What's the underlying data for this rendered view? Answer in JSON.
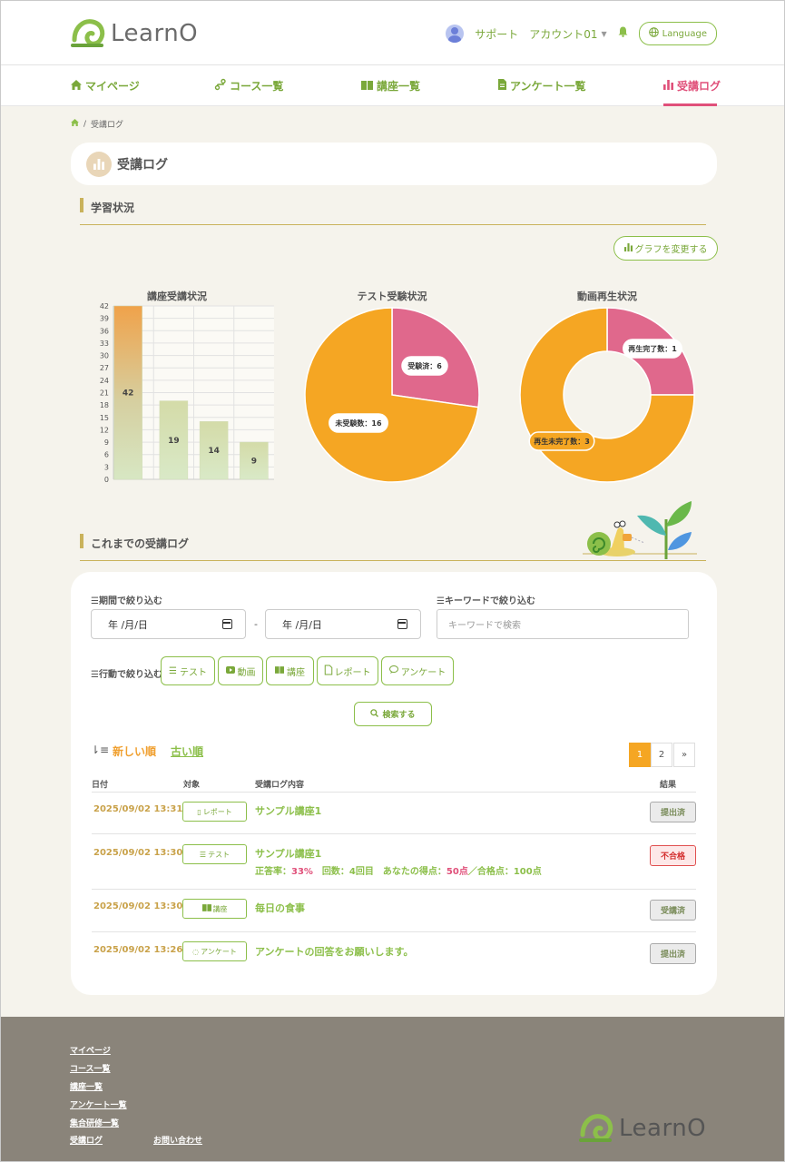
{
  "header": {
    "logo_text": "LearnO",
    "support": "サポート",
    "account": "アカウント01",
    "language": "Language"
  },
  "nav": [
    {
      "label": "マイページ",
      "icon": "home-icon"
    },
    {
      "label": "コース一覧",
      "icon": "route-icon"
    },
    {
      "label": "講座一覧",
      "icon": "book-icon"
    },
    {
      "label": "アンケート一覧",
      "icon": "doc-icon"
    },
    {
      "label": "受講ログ",
      "icon": "bar-chart-icon",
      "active": true
    }
  ],
  "breadcrumb": {
    "current": "受講ログ",
    "sep": "/"
  },
  "page_title": "受講ログ",
  "section1": {
    "heading": "学習状況",
    "graph_button": "グラフを変更する"
  },
  "chart_data": [
    {
      "type": "bar",
      "title": "講座受講状況",
      "categories": [
        "",
        "",
        "",
        ""
      ],
      "values": [
        42,
        19,
        14,
        9
      ],
      "ylim": [
        0,
        42
      ],
      "yticks": [
        0,
        3,
        6,
        9,
        12,
        15,
        18,
        21,
        24,
        27,
        30,
        33,
        36,
        39,
        42
      ],
      "grid": true
    },
    {
      "type": "pie",
      "title": "テスト受験状況",
      "slices": [
        {
          "label": "受験済",
          "value": 6,
          "color": "#e0688c"
        },
        {
          "label": "未受験数",
          "value": 16,
          "color": "#f5a623"
        }
      ]
    },
    {
      "type": "pie",
      "variant": "donut",
      "title": "動画再生状況",
      "slices": [
        {
          "label": "再生完了数",
          "value": 1,
          "color": "#e0688c"
        },
        {
          "label": "再生未完了数",
          "value": 3,
          "color": "#f5a623"
        }
      ]
    }
  ],
  "section2": {
    "heading": "これまでの受講ログ"
  },
  "filters": {
    "period_label": "期間で絞り込む",
    "date_from": "年 /月/日",
    "date_to": "年 /月/日",
    "date_sep": "-",
    "keyword_label": "キーワードで絞り込む",
    "keyword_placeholder": "キーワードで検索",
    "action_label": "行動で絞り込む",
    "chips": [
      "テスト",
      "動画",
      "講座",
      "レポート",
      "アンケート"
    ],
    "search_button": "検索する"
  },
  "sort": {
    "newest": "新しい順",
    "oldest": "古い順"
  },
  "pagination": {
    "pages": [
      "1",
      "2"
    ],
    "next": "»",
    "current": "1"
  },
  "table": {
    "headers": [
      "日付",
      "対象",
      "受講ログ内容",
      "結果"
    ],
    "rows": [
      {
        "date": "2025/09/02 13:31",
        "type": "レポート",
        "content": "サンプル講座1",
        "result": "提出済"
      },
      {
        "date": "2025/09/02 13:30",
        "type": "テスト",
        "content": "サンプル講座1",
        "detail_prefix": "正答率：",
        "rate": "33%",
        "detail_mid": "　回数：4回目　あなたの得点：",
        "score": "50点",
        "detail_suffix": "／合格点：100点",
        "result": "不合格"
      },
      {
        "date": "2025/09/02 13:30",
        "type": "講座",
        "content": "毎日の食事",
        "result": "受講済"
      },
      {
        "date": "2025/09/02 13:26",
        "type": "アンケート",
        "content": "アンケートの回答をお願いします。",
        "result": "提出済"
      }
    ]
  },
  "footer": {
    "links": [
      "マイページ",
      "コース一覧",
      "講座一覧",
      "アンケート一覧",
      "集合研修一覧",
      "受講ログ"
    ],
    "contact": "お問い合わせ",
    "logo_text": "LearnO"
  },
  "colors": {
    "green": "#8cbf4a",
    "pink": "#e0688c",
    "orange": "#f5a623",
    "gold": "#c9b25b"
  }
}
